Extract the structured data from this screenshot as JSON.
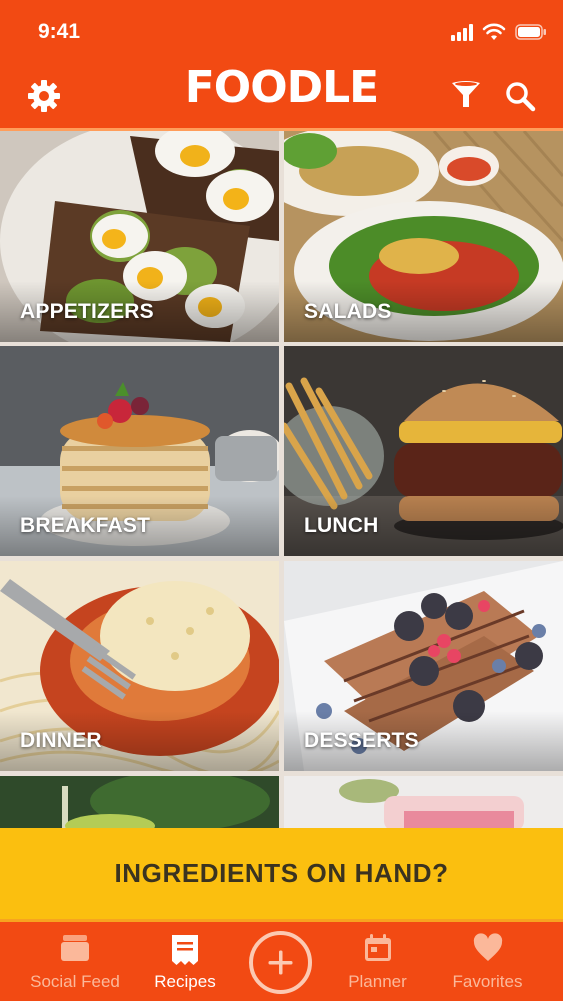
{
  "status": {
    "time": "9:41"
  },
  "header": {
    "logo": "FOODLE"
  },
  "categories": [
    {
      "label": "APPETIZERS"
    },
    {
      "label": "SALADS"
    },
    {
      "label": "BREAKFAST"
    },
    {
      "label": "LUNCH"
    },
    {
      "label": "DINNER"
    },
    {
      "label": "DESSERTS"
    }
  ],
  "ingredients": {
    "label": "INGREDIENTS ON HAND?"
  },
  "tabs": [
    {
      "label": "Social Feed",
      "icon": "social-feed-icon"
    },
    {
      "label": "Recipes",
      "icon": "recipes-icon"
    },
    {
      "label": "Planner",
      "icon": "calendar-icon"
    },
    {
      "label": "Favorites",
      "icon": "heart-icon"
    }
  ],
  "colors": {
    "brand": "#f24a13",
    "accent": "#fbbf0f",
    "tab_inactive": "#fbb89a"
  }
}
